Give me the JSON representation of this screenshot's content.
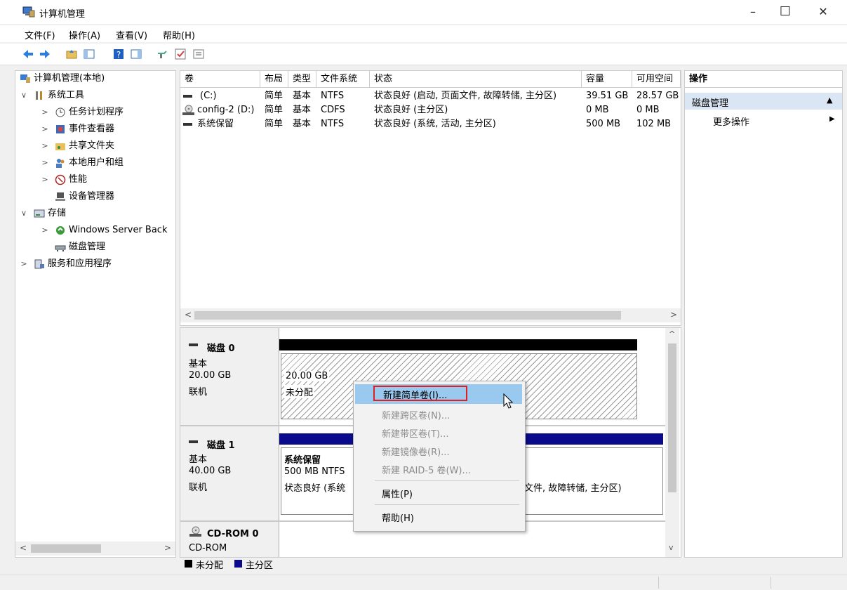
{
  "window": {
    "title": "计算机管理",
    "minimize": "–",
    "maximize": "☐",
    "close": "✕"
  },
  "menu": [
    "文件(F)",
    "操作(A)",
    "查看(V)",
    "帮助(H)"
  ],
  "tree": {
    "root": "计算机管理(本地)",
    "system_tools": "系统工具",
    "task_scheduler": "任务计划程序",
    "event_viewer": "事件查看器",
    "shared_folders": "共享文件夹",
    "local_users": "本地用户和组",
    "performance": "性能",
    "device_manager": "设备管理器",
    "storage": "存储",
    "windows_backup": "Windows Server Back",
    "disk_management": "磁盘管理",
    "services_apps": "服务和应用程序"
  },
  "volumes": {
    "headers": [
      "卷",
      "布局",
      "类型",
      "文件系统",
      "状态",
      "容量",
      "可用空间"
    ],
    "rows": [
      [
        "(C:)",
        "简单",
        "基本",
        "NTFS",
        "状态良好 (启动, 页面文件, 故障转储, 主分区)",
        "39.51 GB",
        "28.57 GB"
      ],
      [
        "config-2 (D:)",
        "简单",
        "基本",
        "CDFS",
        "状态良好 (主分区)",
        "0 MB",
        "0 MB"
      ],
      [
        "系统保留",
        "简单",
        "基本",
        "NTFS",
        "状态良好 (系统, 活动, 主分区)",
        "500 MB",
        "102 MB"
      ]
    ]
  },
  "disks": {
    "disk0": {
      "name": "磁盘 0",
      "type": "基本",
      "size": "20.00 GB",
      "status": "联机",
      "part_size": "20.00 GB",
      "part_label": "未分配"
    },
    "disk1": {
      "name": "磁盘 1",
      "type": "基本",
      "size": "40.00 GB",
      "status": "联机",
      "p1_name": "系统保留",
      "p1_fs": "500 MB NTFS",
      "p1_status": "状态良好 (系统",
      "p2_status": "文件, 故障转储, 主分区)"
    },
    "cdrom": {
      "name": "CD-ROM 0",
      "type": "CD-ROM"
    }
  },
  "legend": {
    "unallocated": "未分配",
    "primary": "主分区"
  },
  "actions": {
    "header": "操作",
    "section": "磁盘管理",
    "more": "更多操作",
    "collapse_glyph": "▲",
    "more_glyph": "▶"
  },
  "context_menu": {
    "new_simple": "新建简单卷(I)...",
    "new_spanned": "新建跨区卷(N)...",
    "new_striped": "新建带区卷(T)...",
    "new_mirrored": "新建镜像卷(R)...",
    "new_raid5": "新建 RAID-5 卷(W)...",
    "properties": "属性(P)",
    "help": "帮助(H)"
  },
  "colors": {
    "accent_select": "#99c9ef",
    "primary_partition": "#0a0a8c",
    "unallocated": "#000000",
    "highlight_box": "#e02020"
  }
}
